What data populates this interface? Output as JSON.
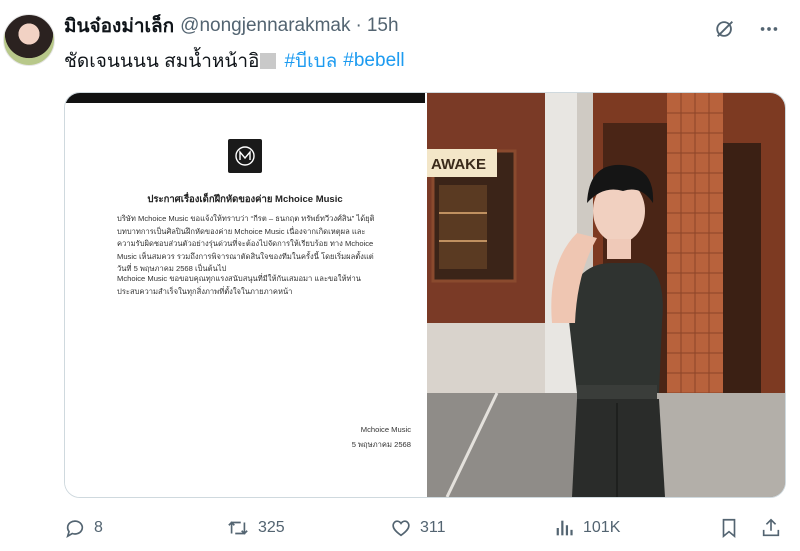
{
  "post": {
    "author_name": "มินจ๋องม่าเล็ก",
    "handle": "@nongjennarakmak",
    "separator": "·",
    "time": "15h",
    "text_prefix": "ชัดเจนนนน สมน้ำหน้าอิ",
    "hashtags": [
      "#บีเบล",
      "#bebell"
    ]
  },
  "icons": {
    "grok": "grok-icon",
    "more": "more-icon",
    "reply": "reply-icon",
    "repost": "repost-icon",
    "like": "heart-icon",
    "views": "views-icon",
    "bookmark": "bookmark-icon",
    "share": "share-icon"
  },
  "document": {
    "title": "ประกาศเรื่องเด็กฝึกหัดของค่าย Mchoice Music",
    "paragraph_1": "บริษัท Mchoice Music ขอแจ้งให้ทราบว่า “กีรต – ธนกฤต ทรัพย์ทวีวงศ์สิน” ได้ยุติบทบาทการเป็นศิลปินฝึกหัดของค่าย Mchoice Music เนื่องจากเกิดเหตุผล และความรับผิดชอบส่วนตัวอย่างรุ่นด่วนที่จะต้องไปจัดการให้เรียบร้อย ทาง Mchoice Music เห็นสมควร รวมถึงการพิจารณาตัดสินใจของทีมในครั้งนี้ โดยเริ่มผลตั้งแต่วันที่ 5 พฤษภาคม 2568 เป็นต้นไป",
    "paragraph_2": "Mchoice Music ขอขอบคุณทุกแรงสนับสนุนที่มีให้กันเสมอมา และขอให้ท่านประสบความสำเร็จในทุกสิ่งภาพที่ตั้งใจในภายภาคหน้า",
    "signature_org": "Mchoice Music",
    "signature_date": "5 พฤษภาคม 2568"
  },
  "photo": {
    "sign_text": "AWAKE"
  },
  "actions": {
    "replies": "8",
    "reposts": "325",
    "likes": "311",
    "views": "101K"
  },
  "colors": {
    "accent": "#1d9bf0",
    "muted": "#536471",
    "text": "#0f1419",
    "border": "#cfd9de"
  }
}
